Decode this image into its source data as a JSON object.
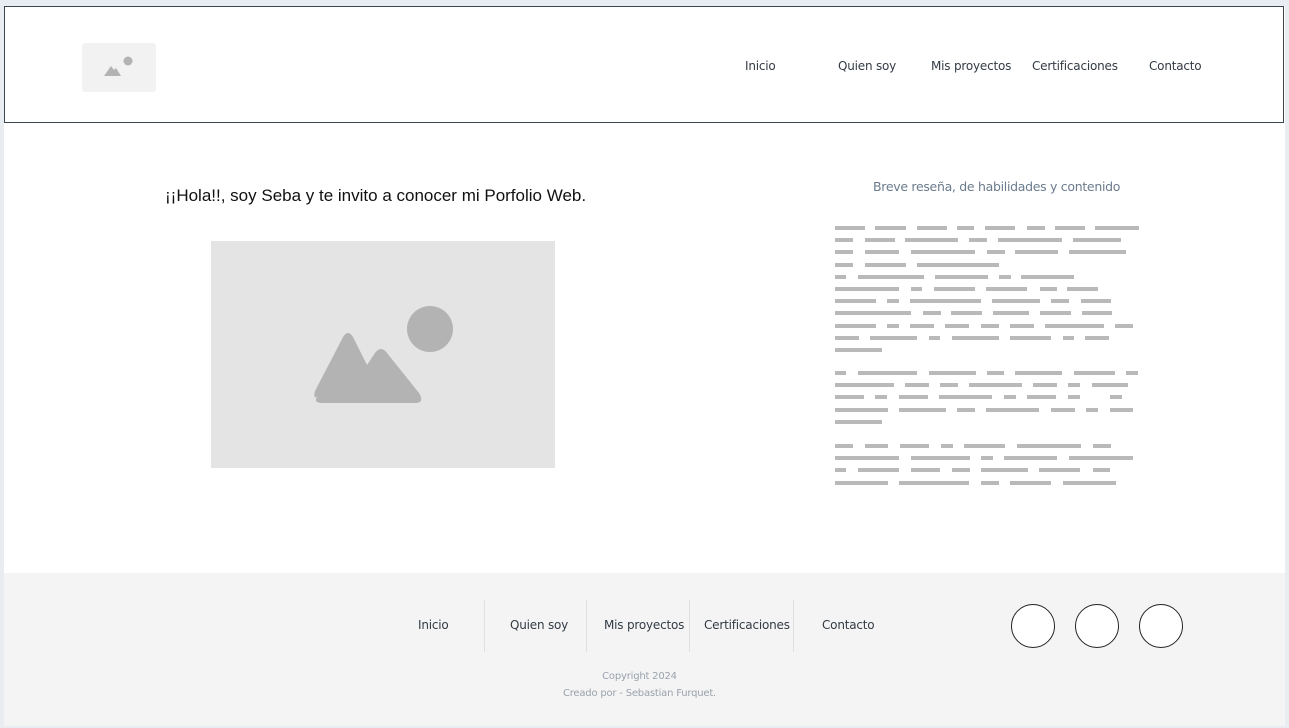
{
  "header": {
    "logo_icon": "image-placeholder-icon",
    "nav": [
      "Inicio",
      "Quien soy",
      "Mis proyectos",
      "Certificaciones",
      "Contacto"
    ]
  },
  "main": {
    "greeting": "¡¡Hola!!, soy Seba y te invito a conocer mi Porfolio Web.",
    "hero_image_icon": "image-placeholder-icon",
    "summary_title": "Breve reseña, de habilidades y contenido"
  },
  "footer": {
    "nav": [
      "Inicio",
      "Quien soy",
      "Mis proyectos",
      "Certificaciones",
      "Contacto"
    ],
    "social_icons": [
      "social-circle-1-icon",
      "social-circle-2-icon",
      "social-circle-3-icon"
    ],
    "copyright": "Copyright 2024",
    "credits": "Creado por - Sebastian Furquet."
  },
  "colors": {
    "placeholder_bg": "#e4e4e4",
    "placeholder_shape": "#b3b3b3",
    "footer_bg": "#f4f4f4",
    "summary_title": "#6b7b8d"
  }
}
